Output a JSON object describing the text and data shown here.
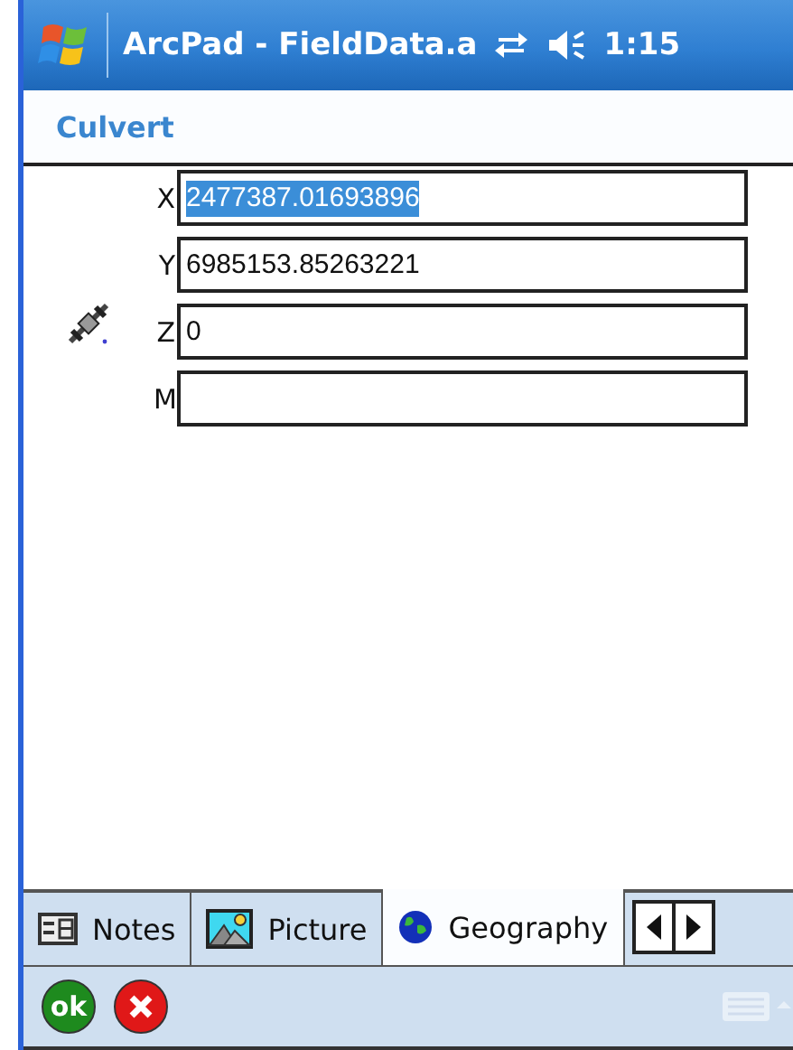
{
  "title_bar": {
    "title": "ArcPad - FieldData.a",
    "time": "1:15"
  },
  "form": {
    "title": "Culvert"
  },
  "fields": [
    {
      "label": "X",
      "value": "2477387.01693896",
      "selected": true
    },
    {
      "label": "Y",
      "value": "6985153.85263221",
      "selected": false
    },
    {
      "label": "Z",
      "value": "0",
      "selected": false
    },
    {
      "label": "M",
      "selected": false
    }
  ],
  "tabs": [
    {
      "label": "Notes",
      "kind": "notes",
      "selected": false
    },
    {
      "label": "Picture",
      "kind": "picture",
      "selected": false
    },
    {
      "label": "Geography",
      "kind": "geography",
      "selected": true
    }
  ],
  "buttons": [
    {
      "kind": "ok",
      "label": "ok"
    },
    {
      "kind": "cancel"
    }
  ]
}
